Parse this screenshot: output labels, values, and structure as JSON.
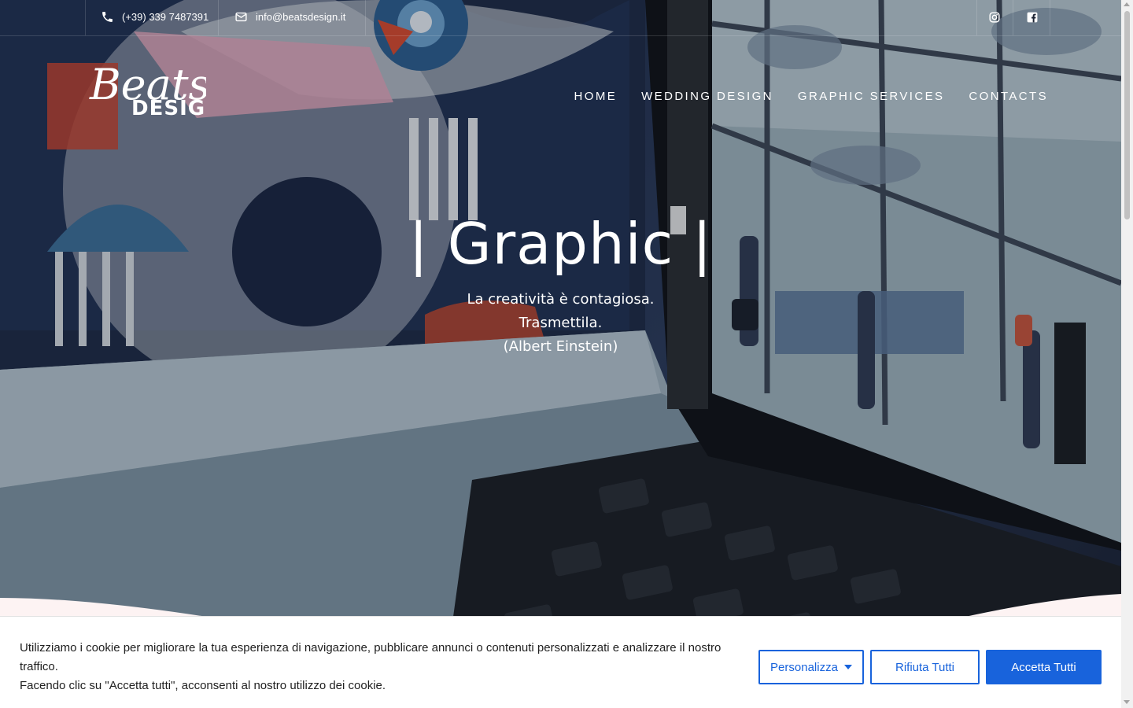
{
  "topbar": {
    "phone": "(+39) 339 7487391",
    "email": "info@beatsdesign.it",
    "social_icons": [
      "instagram-icon",
      "facebook-icon"
    ]
  },
  "logo": {
    "script_text": "Beats",
    "block_text": "DESIGN"
  },
  "nav": {
    "items": [
      {
        "label": "HOME"
      },
      {
        "label": "WEDDING DESIGN"
      },
      {
        "label": "GRAPHIC SERVICES"
      },
      {
        "label": "CONTACTS"
      }
    ]
  },
  "hero": {
    "title": "| Graphic |",
    "quote_line1": "La creatività è contagiosa.",
    "quote_line2": "Trasmettila.",
    "quote_line3": "(Albert Einstein)"
  },
  "cookie": {
    "text_line1": "Utilizziamo i cookie per migliorare la tua esperienza di navigazione, pubblicare annunci o contenuti personalizzati e analizzare il nostro traffico.",
    "text_line2": "Facendo clic su \"Accetta tutti\", acconsenti al nostro utilizzo dei cookie.",
    "customize_label": "Personalizza",
    "reject_label": "Rifiuta Tutti",
    "accept_label": "Accetta Tutti"
  },
  "colors": {
    "accent": "#1863dc",
    "text_dark": "#212121",
    "hero_text": "#ffffff"
  }
}
